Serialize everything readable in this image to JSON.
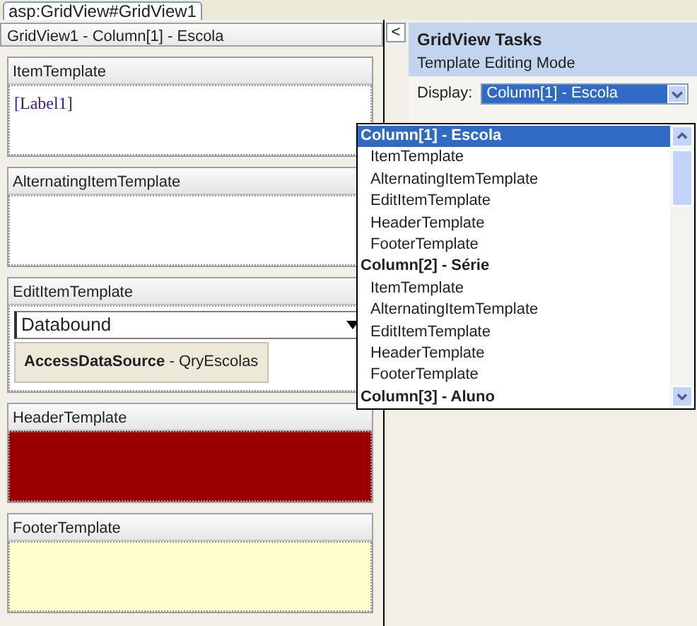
{
  "tab": {
    "label": "asp:GridView#GridView1"
  },
  "editor": {
    "title": "GridView1 - Column[1] - Escola",
    "templates": [
      {
        "title": "ItemTemplate",
        "kind": "label",
        "content": "[Label1]"
      },
      {
        "title": "AlternatingItemTemplate",
        "kind": "empty"
      },
      {
        "title": "EditItemTemplate",
        "kind": "dropdown",
        "value": "Databound",
        "tag": "**AccessDataSource** - QryEscolas"
      },
      {
        "title": "HeaderTemplate",
        "kind": "filled",
        "color": "#990000"
      },
      {
        "title": "FooterTemplate",
        "kind": "filled",
        "color": "#ffffcc"
      }
    ]
  },
  "collapse_button": {
    "glyph": "<"
  },
  "tasks": {
    "title": "GridView Tasks",
    "subtitle": "Template Editing Mode",
    "display_label": "Display:",
    "display_value": "Column[1] - Escola"
  },
  "dropdown": {
    "items": [
      {
        "text": "Column[1] - Escola",
        "kind": "group",
        "selected": true
      },
      {
        "text": "ItemTemplate",
        "kind": "template",
        "selected": false
      },
      {
        "text": "AlternatingItemTemplate",
        "kind": "template",
        "selected": false
      },
      {
        "text": "EditItemTemplate",
        "kind": "template",
        "selected": false
      },
      {
        "text": "HeaderTemplate",
        "kind": "template",
        "selected": false
      },
      {
        "text": "FooterTemplate",
        "kind": "template",
        "selected": false
      },
      {
        "text": "Column[2] - Série",
        "kind": "group",
        "selected": false
      },
      {
        "text": "ItemTemplate",
        "kind": "template",
        "selected": false
      },
      {
        "text": "AlternatingItemTemplate",
        "kind": "template",
        "selected": false
      },
      {
        "text": "EditItemTemplate",
        "kind": "template",
        "selected": false
      },
      {
        "text": "HeaderTemplate",
        "kind": "template",
        "selected": false
      },
      {
        "text": "FooterTemplate",
        "kind": "template",
        "selected": false
      },
      {
        "text": "Column[3] - Aluno",
        "kind": "group",
        "selected": false
      }
    ]
  }
}
